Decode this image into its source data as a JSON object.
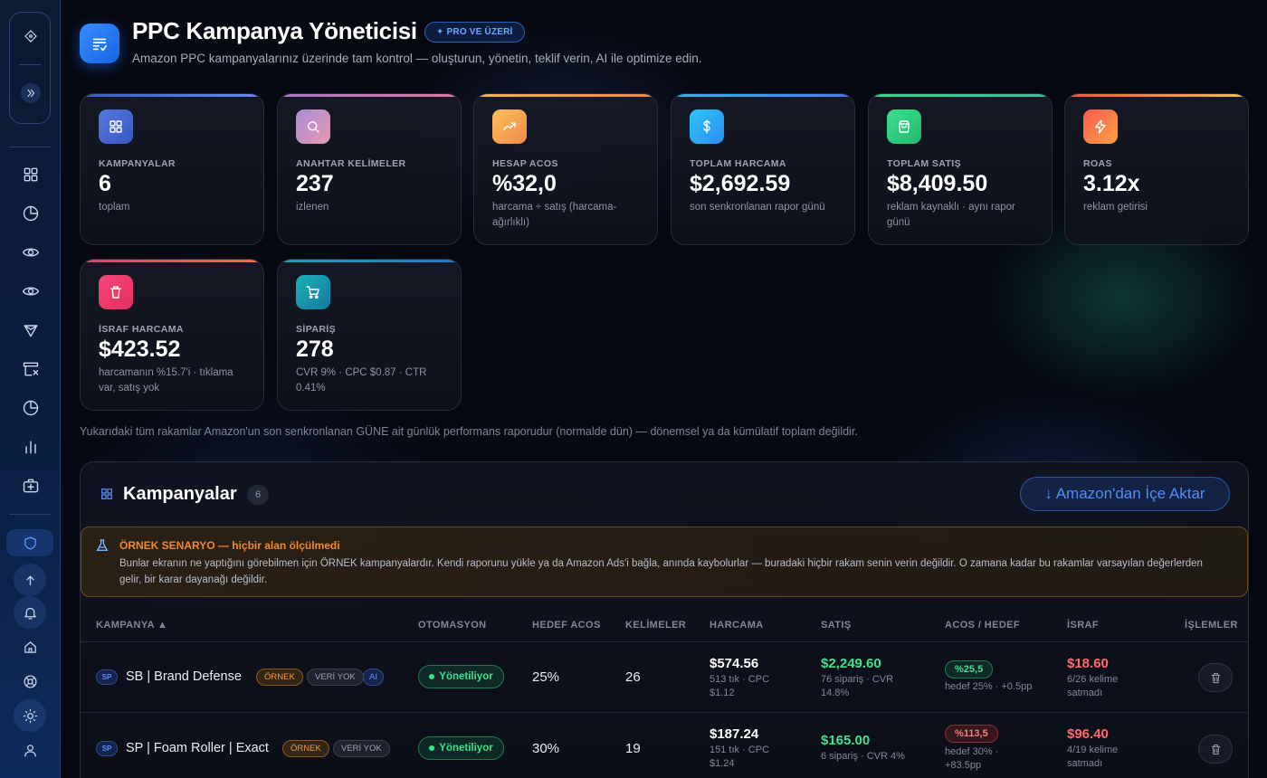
{
  "header": {
    "title": "PPC Kampanya Yöneticisi",
    "badge": "✦ PRO VE ÜZERİ",
    "subtitle": "Amazon PPC kampanyalarınız üzerinde tam kontrol — oluşturun, yönetin, teklif verin, AI ile optimize edin."
  },
  "stats": [
    {
      "label": "KAMPANYALAR",
      "value": "6",
      "sub": "toplam",
      "icon": "grid-icon",
      "color": "#4a6fdc"
    },
    {
      "label": "ANAHTAR KELİMELER",
      "value": "237",
      "sub": "izlenen",
      "icon": "search-icon",
      "color": "#c07fb8"
    },
    {
      "label": "HESAP ACOS",
      "value": "%32,0",
      "sub": "harcama ÷ satış (harcama-ağırlıklı)",
      "icon": "trend-icon",
      "color": "#f5a24a"
    },
    {
      "label": "TOPLAM HARCAMA",
      "value": "$2,692.59",
      "sub": "son senkronlanan rapor günü",
      "icon": "dollar-icon",
      "color": "#26a8e8"
    },
    {
      "label": "TOPLAM SATIŞ",
      "value": "$8,409.50",
      "sub": "reklam kaynaklı · aynı rapor günü",
      "icon": "bag-icon",
      "color": "#2ecc71"
    },
    {
      "label": "ROAS",
      "value": "3.12x",
      "sub": "reklam getirisi",
      "icon": "bolt-icon",
      "color": "#f5663a"
    },
    {
      "label": "İSRAF HARCAMA",
      "value": "$423.52",
      "sub": "harcamanın %15.7'i · tıklama var, satış yok",
      "icon": "trash-icon",
      "color": "#f0386e"
    },
    {
      "label": "SİPARİŞ",
      "value": "278",
      "sub": "CVR 9% · CPC $0.87 · CTR 0.41%",
      "icon": "cart-icon",
      "color": "#16a4b0"
    }
  ],
  "note": "Yukarıdaki tüm rakamlar Amazon'un son senkronlanan GÜNE ait günlük performans raporudur (normalde dün) — dönemsel ya da kümülatif toplam değildir.",
  "panel": {
    "title": "Kampanyalar",
    "count": "6",
    "import_label": "↓ Amazon'dan İçe Aktar",
    "scenario_title": "ÖRNEK SENARYO — hiçbir alan ölçülmedi",
    "scenario_body": "Bunlar ekranın ne yaptığını görebilmen için ÖRNEK kampanyalardır. Kendi raporunu yükle ya da Amazon Ads'i bağla, anında kaybolurlar — buradaki hiçbir rakam senin verin değildir. O zamana kadar bu rakamlar varsayılan değerlerden gelir, bir karar dayanağı değildir."
  },
  "columns": [
    "KAMPANYA ▲",
    "OTOMASYON",
    "HEDEF ACOS",
    "KELİMELER",
    "HARCAMA",
    "SATIŞ",
    "ACOS / HEDEF",
    "İSRAF",
    "İŞLEMLER"
  ],
  "rows": [
    {
      "type": "SP",
      "name": "SB | Brand Defense",
      "tag_ornek": "ÖRNEK",
      "tag_veri": "VERİ YOK",
      "tag_ai": "AI",
      "automation": "Yönetiliyor",
      "target_acos": "25%",
      "keywords": "26",
      "spend": "$574.56",
      "spend_sub": "513 tık · CPC $1.12",
      "sales": "$2,249.60",
      "sales_sub": "76 sipariş · CVR 14.8%",
      "acos": "%25,5",
      "acos_sub": "hedef 25% · +0.5pp",
      "acos_status": "good",
      "waste": "$18.60",
      "waste_sub": "6/26 kelime satmadı"
    },
    {
      "type": "SP",
      "name": "SP | Foam Roller | Exact",
      "tag_ornek": "ÖRNEK",
      "tag_veri": "VERİ YOK",
      "automation": "Yönetiliyor",
      "target_acos": "30%",
      "keywords": "19",
      "spend": "$187.24",
      "spend_sub": "151 tık · CPC $1.24",
      "sales": "$165.00",
      "sales_sub": "6 sipariş · CVR 4%",
      "acos": "%113,5",
      "acos_sub": "hedef 30% · +83.5pp",
      "acos_status": "bad",
      "waste": "$96.40",
      "waste_sub": "4/19 kelime satmadı"
    }
  ]
}
